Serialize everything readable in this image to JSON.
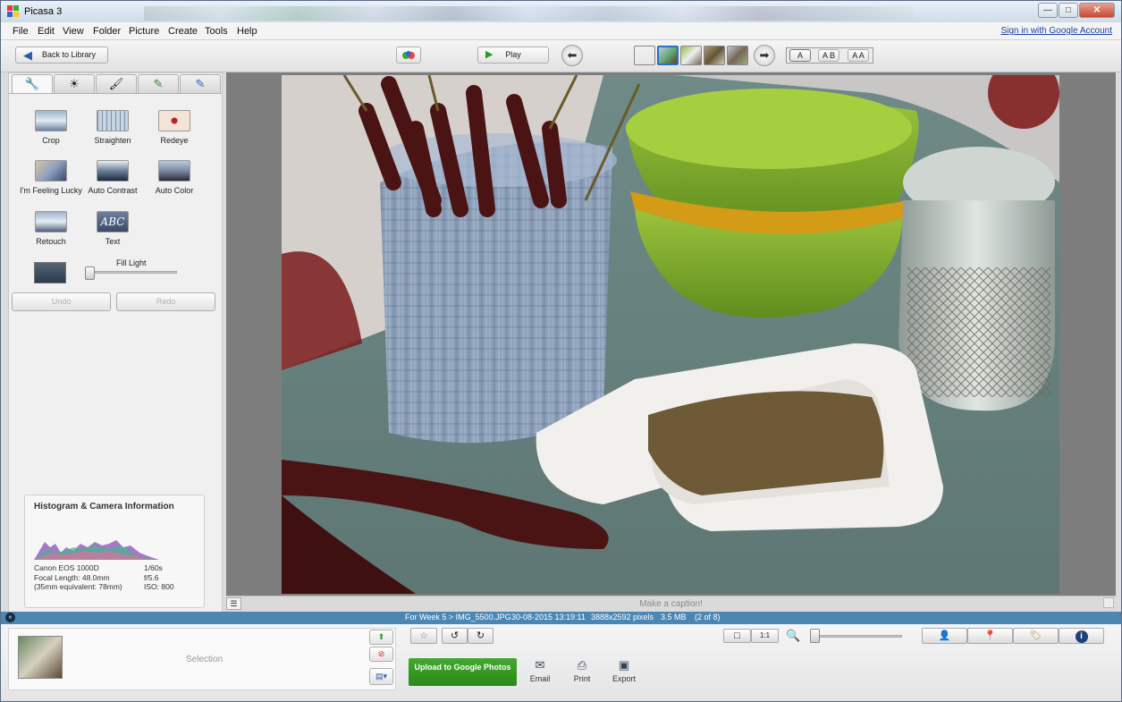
{
  "window": {
    "title": "Picasa 3",
    "minimize": "—",
    "maximize": "□",
    "close": "✕"
  },
  "menu": {
    "items": [
      "File",
      "Edit",
      "View",
      "Folder",
      "Picture",
      "Create",
      "Tools",
      "Help"
    ],
    "signin": "Sign in with Google Account"
  },
  "toolbar": {
    "back_label": "Back to Library",
    "play_label": "Play",
    "prev_icon": "left-arrow-icon",
    "next_icon": "right-arrow-icon",
    "text_modes": [
      "A",
      "A B",
      "A A"
    ]
  },
  "edit_tabs": [
    "wrench-icon",
    "sun-icon",
    "brush-icon",
    "effects-icon",
    "paint-icon"
  ],
  "tools": [
    {
      "label": "Crop"
    },
    {
      "label": "Straighten"
    },
    {
      "label": "Redeye"
    },
    {
      "label": "I'm Feeling Lucky"
    },
    {
      "label": "Auto Contrast"
    },
    {
      "label": "Auto Color"
    },
    {
      "label": "Retouch"
    },
    {
      "label": "Text",
      "icon_text": "ABC"
    }
  ],
  "fill_light": {
    "label": "Fill Light",
    "value": 0
  },
  "undo_label": "Undo",
  "redo_label": "Redo",
  "histogram": {
    "title": "Histogram & Camera Information",
    "camera": "Canon EOS 1000D",
    "focal": "Focal Length: 48.0mm",
    "equiv": "(35mm equivalent:  78mm)",
    "shutter": "1/60s",
    "aperture": "f/5.6",
    "iso": "ISO: 800"
  },
  "caption_placeholder": "Make a caption!",
  "status": {
    "path": "For Week 5 > IMG_5500.JPG",
    "datetime": "30-08-2015 13:19:11",
    "dimensions": "3888x2592 pixels",
    "size": "3.5 MB",
    "position": "(2 of 8)"
  },
  "bottom": {
    "selection_label": "Selection",
    "upload_label": "Upload to Google Photos",
    "email_label": "Email",
    "print_label": "Print",
    "export_label": "Export",
    "zoom_level": 0,
    "sizes": [
      "□",
      "1:1"
    ]
  },
  "colors": {
    "status_bar": "#4c87b4",
    "upload_green": "#2b8a18",
    "link": "#1a3fa8"
  }
}
